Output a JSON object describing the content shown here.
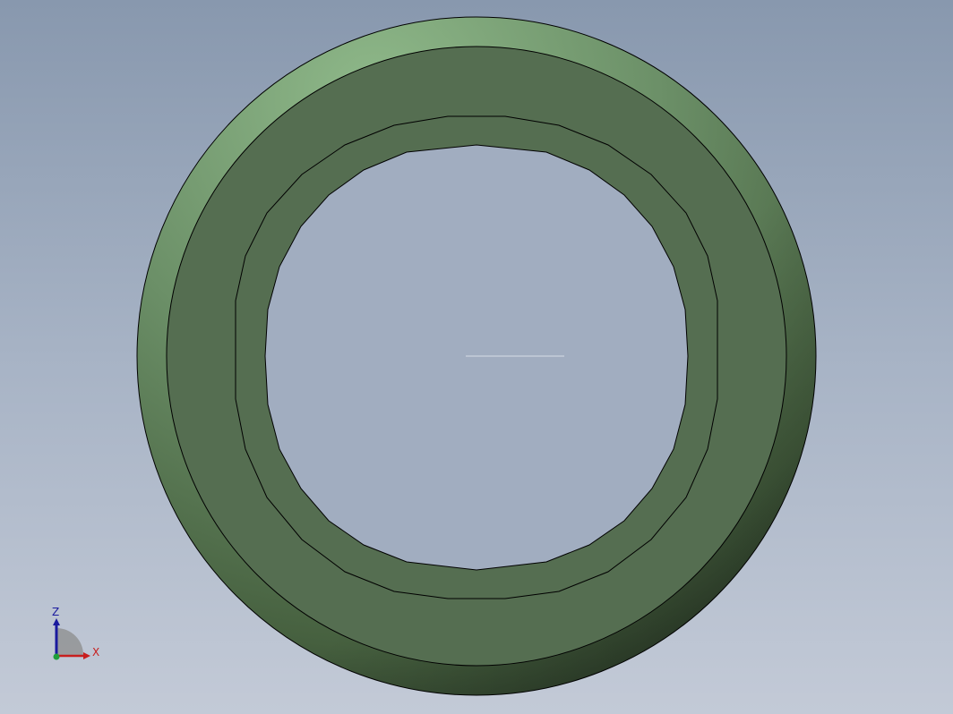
{
  "view": {
    "background_top": "#8898ae",
    "background_bottom": "#c3cad7"
  },
  "part": {
    "shape": "ring",
    "face_color": "#556e51",
    "highlight_color": "#7fa57a",
    "edge_color": "#000000"
  },
  "triad": {
    "x_label": "X",
    "z_label": "Z",
    "x_color": "#c81e1e",
    "z_color": "#1a1a9e",
    "y_color": "#1e9e3a"
  }
}
